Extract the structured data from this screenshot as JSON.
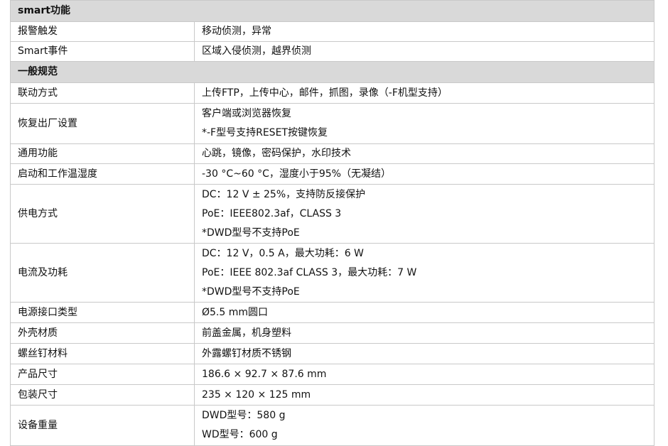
{
  "sections": [
    {
      "title": "smart功能",
      "rows": [
        {
          "label": "报警触发",
          "values": [
            "移动侦测，异常"
          ]
        },
        {
          "label": "Smart事件",
          "values": [
            "区域入侵侦测，越界侦测"
          ]
        }
      ]
    },
    {
      "title": "一般规范",
      "rows": [
        {
          "label": "联动方式",
          "values": [
            "上传FTP，上传中心，邮件，抓图，录像（-F机型支持）"
          ]
        },
        {
          "label": "恢复出厂设置",
          "values": [
            "客户端或浏览器恢复",
            "*-F型号支持RESET按键恢复"
          ]
        },
        {
          "label": "通用功能",
          "values": [
            "心跳，镜像，密码保护，水印技术"
          ]
        },
        {
          "label": "启动和工作温湿度",
          "values": [
            "-30 °C~60 °C，湿度小于95%（无凝结）"
          ]
        },
        {
          "label": "供电方式",
          "values": [
            "DC：12 V ± 25%，支持防反接保护",
            "PoE：IEEE802.3af，CLASS 3",
            "*DWD型号不支持PoE"
          ]
        },
        {
          "label": "电流及功耗",
          "values": [
            "DC：12 V，0.5 A，最大功耗：6 W",
            "PoE：IEEE 802.3af CLASS 3，最大功耗：7 W",
            "*DWD型号不支持PoE"
          ]
        },
        {
          "label": "电源接口类型",
          "values": [
            "Ø5.5 mm圆口"
          ]
        },
        {
          "label": "外壳材质",
          "values": [
            "前盖金属，机身塑料"
          ]
        },
        {
          "label": "螺丝钉材料",
          "values": [
            "外露螺钉材质不锈钢"
          ]
        },
        {
          "label": "产品尺寸",
          "values": [
            "186.6 × 92.7 × 87.6 mm"
          ]
        },
        {
          "label": "包装尺寸",
          "values": [
            "235 × 120 × 125 mm"
          ]
        },
        {
          "label": "设备重量",
          "values": [
            "DWD型号：580 g",
            "WD型号：600 g"
          ]
        }
      ]
    }
  ]
}
